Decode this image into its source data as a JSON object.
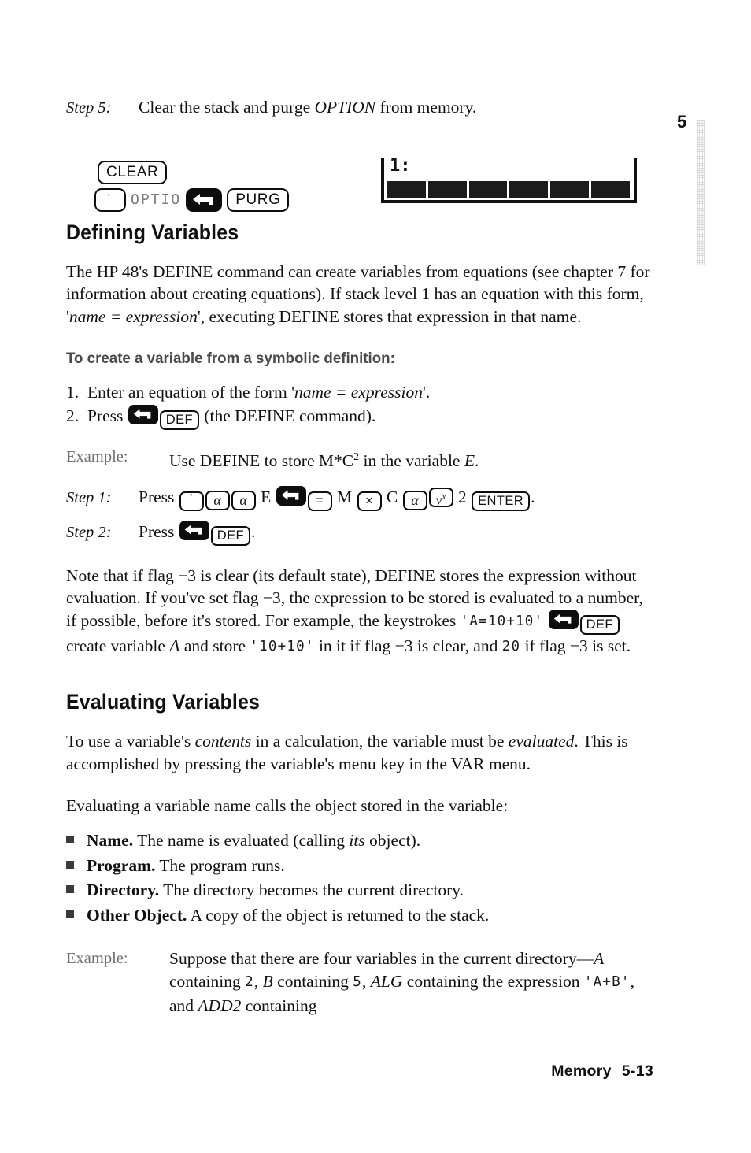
{
  "chapter_marker": "5",
  "step5": {
    "label": "Step 5:",
    "text_before": "Clear the stack and purge ",
    "emphasis": "OPTION",
    "text_after": " from memory.",
    "keys": {
      "clear": "CLEAR",
      "tick": "'",
      "calc_text": "OPTIO",
      "shift": "left-shift-arrow",
      "purg": "PURG"
    },
    "display": {
      "stack_level": "1:",
      "menu_slots": 6
    }
  },
  "defining": {
    "heading": "Defining Variables",
    "paragraph_1a": "The HP 48's DEFINE command can create variables from equations (see chapter 7 for information about creating equations). If stack level 1 has an equation with this form, '",
    "paragraph_1_em": "name = expression",
    "paragraph_1b": "', executing DEFINE stores that expression in that name.",
    "subheading": "To create a variable from a symbolic definition:",
    "steps": [
      {
        "num": "1.",
        "text_a": "Enter an equation of the form '",
        "em": "name = expression",
        "text_b": "'."
      },
      {
        "num": "2.",
        "text_a": "Press ",
        "key_shift": "left-shift-arrow",
        "key_def": "DEF",
        "text_b": " (the DEFINE command)."
      }
    ],
    "example": {
      "label": "Example:",
      "text_a": "Use DEFINE to store M*C",
      "sup": "2",
      "text_b": " in the variable ",
      "var": "E",
      "text_c": "."
    },
    "step1": {
      "label": "Step 1:",
      "press": "Press ",
      "keys": [
        "'",
        "alpha",
        "alpha",
        "E",
        "left-shift-arrow",
        "=",
        "M",
        "x",
        "C",
        "alpha",
        "y-to-x",
        "2",
        "ENTER"
      ],
      "key_labels": {
        "tick": "'",
        "alpha": "α",
        "E": "E",
        "equals": "=",
        "M": "M",
        "times": "×",
        "C": "C",
        "ypow": "y",
        "ypow_sup": "x",
        "two": "2",
        "enter": "ENTER"
      },
      "period": "."
    },
    "step2": {
      "label": "Step 2:",
      "press": "Press ",
      "key_shift": "left-shift-arrow",
      "key_def": "DEF",
      "period": "."
    },
    "note_1": "Note that if flag −3 is clear (its default state), DEFINE stores the expression without evaluation. If you've set flag −3, the expression to be stored is evaluated to a number, if possible, before it's stored. For example, the keystrokes ",
    "note_calc_1": "'A=10+10'",
    "note_2": " create variable ",
    "note_var_a": "A",
    "note_3": " and store ",
    "note_calc_2": "'10+10'",
    "note_4": " in it if flag −3 is clear, and ",
    "note_calc_3": "20",
    "note_5": " if flag −3 is set.",
    "note_key_shift": "left-shift-arrow",
    "note_key_def": "DEF"
  },
  "evaluating": {
    "heading": "Evaluating Variables",
    "paragraph_1a": "To use a variable's ",
    "paragraph_1_em1": "contents",
    "paragraph_1b": " in a calculation, the variable must be ",
    "paragraph_1_em2": "evaluated",
    "paragraph_1c": ". This is accomplished by pressing the variable's menu key in the VAR menu.",
    "paragraph_2": "Evaluating a variable name calls the object stored in the variable:",
    "bullets": [
      {
        "term": "Name.",
        "text_a": " The name is evaluated (calling ",
        "em": "its",
        "text_b": " object)."
      },
      {
        "term": "Program.",
        "text_a": " The program runs.",
        "em": "",
        "text_b": ""
      },
      {
        "term": "Directory.",
        "text_a": " The directory becomes the current directory.",
        "em": "",
        "text_b": ""
      },
      {
        "term": "Other Object.",
        "text_a": " A copy of the object is returned to the stack.",
        "em": "",
        "text_b": ""
      }
    ],
    "example": {
      "label": "Example:",
      "t1": "Suppose that there are four variables in the current directory—",
      "var_a": "A",
      "t2": " containing ",
      "calc_2": "2",
      "t3": ", ",
      "var_b": "B",
      "t4": " containing ",
      "calc_5": "5",
      "t5": ", ",
      "var_alg": "ALG",
      "t6": " containing the expression ",
      "calc_ab": "'A+B'",
      "t7": ", and ",
      "var_add2": "ADD2",
      "t8": " containing"
    }
  },
  "footer": {
    "chapter_name": "Memory",
    "page_number": "5-13"
  }
}
